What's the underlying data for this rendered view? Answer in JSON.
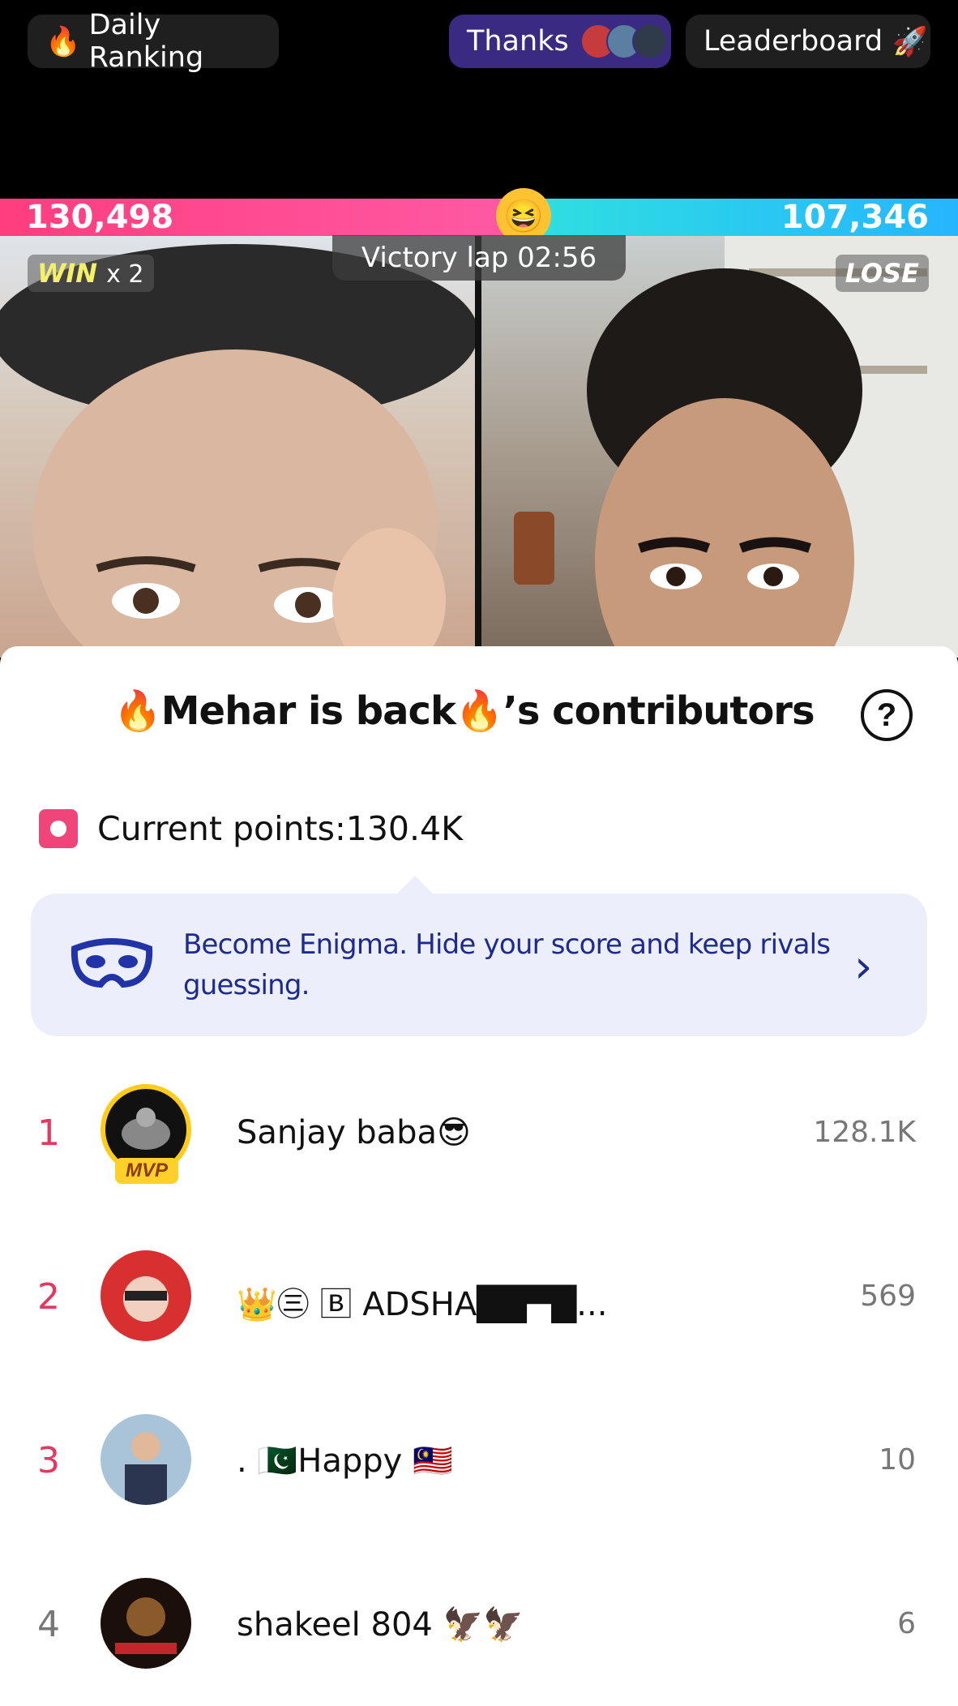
{
  "header": {
    "daily_ranking": "Daily Ranking",
    "thanks": "Thanks",
    "leaderboard": "Leaderboard"
  },
  "battle": {
    "left_score": "130,498",
    "right_score": "107,346",
    "victory_lap": "Victory lap 02:56",
    "left_badge_win": "WIN",
    "left_badge_multiplier": "x 2",
    "right_badge": "LOSE",
    "left_bar_fraction": 0.549
  },
  "panel": {
    "title": "🔥Mehar is back🔥’s contributors",
    "help": "?",
    "current_points": "Current points:130.4K",
    "enigma_text": "Become Enigma. Hide your score and keep rivals guessing.",
    "chevron": "›"
  },
  "contributors": [
    {
      "rank": "1",
      "name": "Sanjay baba😎",
      "score": "128.1K",
      "badge": "MVP"
    },
    {
      "rank": "2",
      "name": "👑㊂ 🄱 ADSHA██▀█...",
      "score": "569"
    },
    {
      "rank": "3",
      "name": ". 🇵🇰Happy 🇲🇾",
      "score": "10"
    },
    {
      "rank": "4",
      "name": "shakeel  804 🦅🦅",
      "score": "6"
    }
  ],
  "colors": {
    "accent_pink": "#ff3d7f",
    "accent_cyan": "#2fe0e0",
    "rank_red": "#e6375f",
    "enigma_blue": "#1d2a8f"
  }
}
